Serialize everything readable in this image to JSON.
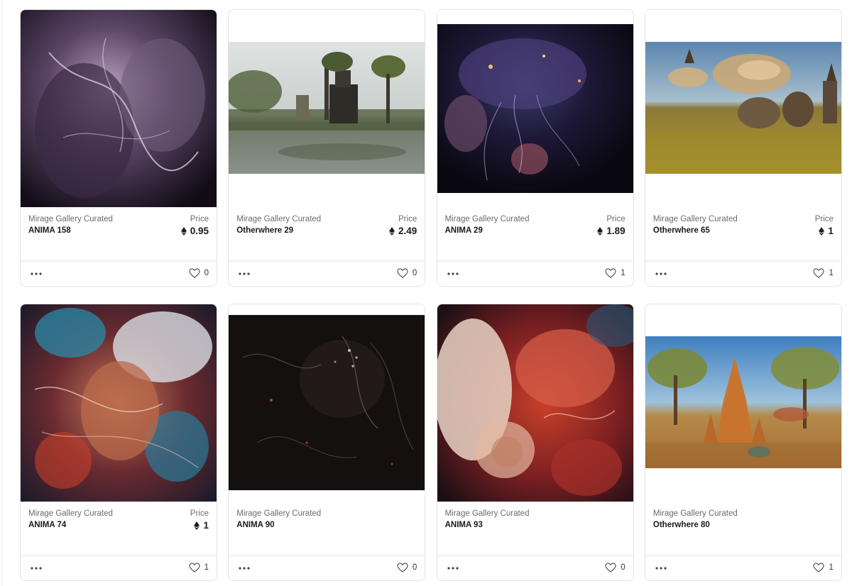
{
  "labels": {
    "price": "Price"
  },
  "cards": [
    {
      "creator": "Mirage Gallery Curated",
      "title": "ANIMA 158",
      "price": "0.95",
      "likes": "0",
      "image": "purple sculptural figures with tendril roots"
    },
    {
      "creator": "Mirage Gallery Curated",
      "title": "Otherwhere 29",
      "price": "2.49",
      "likes": "0",
      "image": "ornate tower in a misty swamp with trees"
    },
    {
      "creator": "Mirage Gallery Curated",
      "title": "ANIMA 29",
      "price": "1.89",
      "likes": "1",
      "image": "glowing bioluminescent creature on dark background"
    },
    {
      "creator": "Mirage Gallery Curated",
      "title": "Otherwhere 65",
      "price": "1",
      "likes": "1",
      "image": "domed structures in a golden meadow under clouds"
    },
    {
      "creator": "Mirage Gallery Curated",
      "title": "ANIMA 74",
      "price": "1",
      "likes": "1",
      "image": "face surrounded by red and blue swirling forms"
    },
    {
      "creator": "Mirage Gallery Curated",
      "title": "ANIMA 90",
      "price": "",
      "likes": "0",
      "image": "dark tendrils with glowing specks"
    },
    {
      "creator": "Mirage Gallery Curated",
      "title": "ANIMA 93",
      "price": "",
      "likes": "0",
      "image": "translucent figures in red organic forms"
    },
    {
      "creator": "Mirage Gallery Curated",
      "title": "Otherwhere 80",
      "price": "",
      "likes": "1",
      "image": "orange towers in a savanna with trees"
    }
  ],
  "colors": {
    "border": "#e3e3e3",
    "text_primary": "#1a1a1a",
    "text_secondary": "#6b6b6b"
  }
}
